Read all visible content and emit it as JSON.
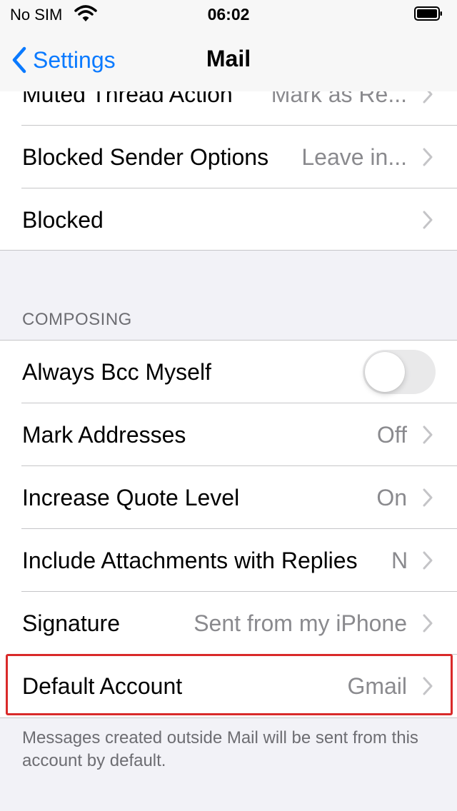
{
  "status_bar": {
    "carrier": "No SIM",
    "time": "06:02"
  },
  "nav": {
    "back_label": "Settings",
    "title": "Mail"
  },
  "rows_top": [
    {
      "label": "Muted Thread Action",
      "value": "Mark as Re..."
    },
    {
      "label": "Blocked Sender Options",
      "value": "Leave in..."
    },
    {
      "label": "Blocked",
      "value": ""
    }
  ],
  "composing": {
    "header": "COMPOSING",
    "always_bcc": {
      "label": "Always Bcc Myself",
      "enabled": false
    },
    "rows": [
      {
        "label": "Mark Addresses",
        "value": "Off"
      },
      {
        "label": "Increase Quote Level",
        "value": "On"
      },
      {
        "label": "Include Attachments with Replies",
        "value": "N"
      },
      {
        "label": "Signature",
        "value": "Sent from my iPhone"
      },
      {
        "label": "Default Account",
        "value": "Gmail"
      }
    ],
    "footer": "Messages created outside Mail will be sent from this account by default."
  },
  "colors": {
    "accent": "#0a7aff",
    "highlight": "#d92a2a"
  }
}
